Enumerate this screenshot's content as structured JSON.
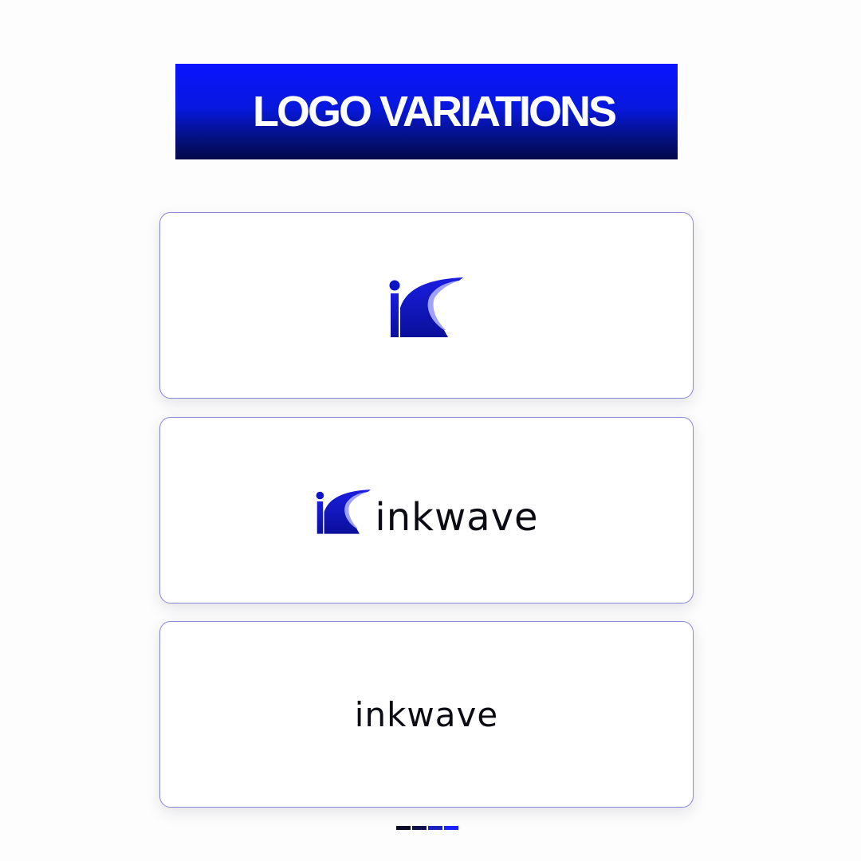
{
  "banner": {
    "title": "LOGO VARIATIONS"
  },
  "cards": [
    {
      "variant": "logo-mark"
    },
    {
      "variant": "logo-mark-with-wordmark",
      "wordmark": "inkwave"
    },
    {
      "variant": "wordmark",
      "wordmark": "inkwave"
    }
  ],
  "colors": {
    "brand_blue": "#0a14ff",
    "brand_navy": "#020848",
    "mark_blue": "#0d15c8",
    "wordmark_black": "#0b0b14",
    "card_border": "#8a86d8"
  },
  "pager": {
    "segments": [
      "#0a0a2a",
      "#101050",
      "#1a22c0",
      "#1a22ff"
    ]
  }
}
